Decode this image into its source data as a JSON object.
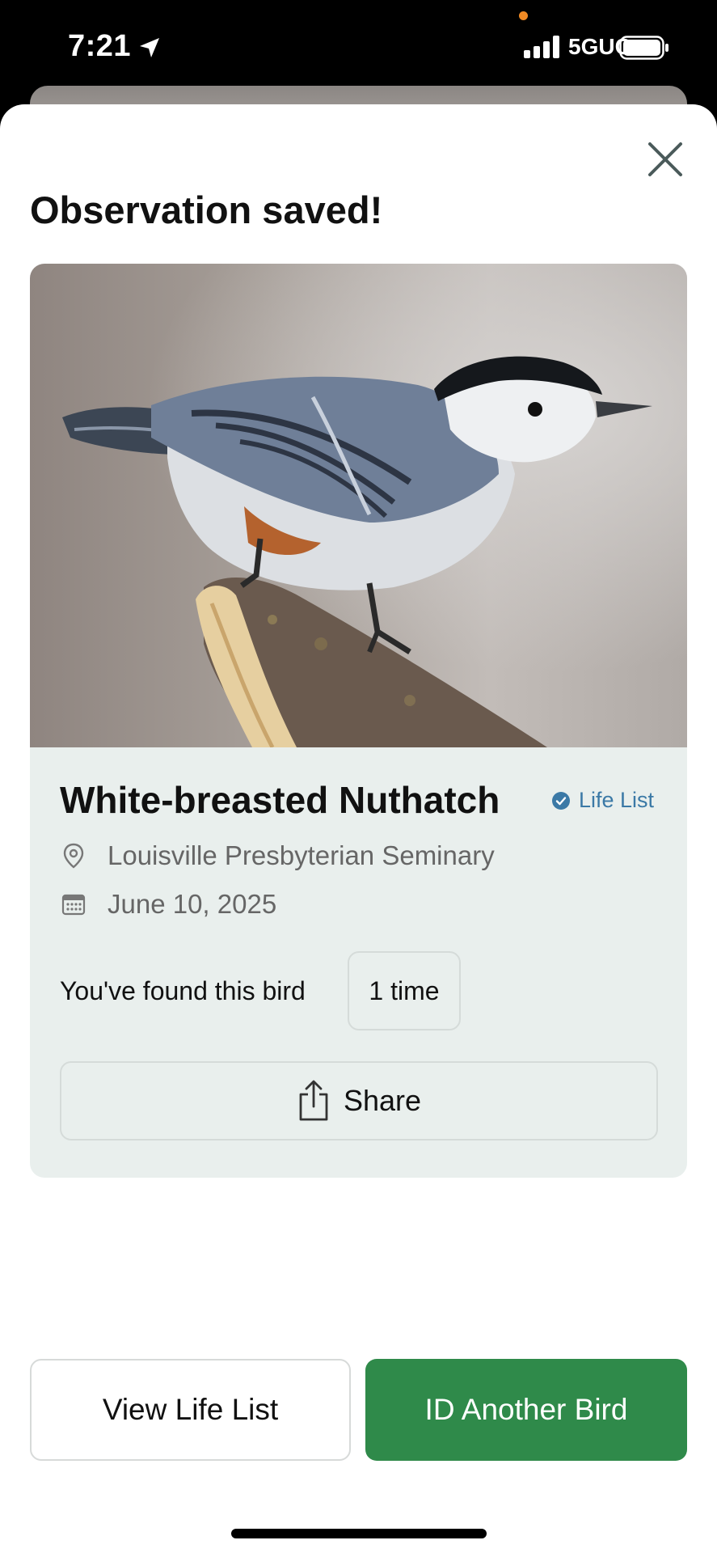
{
  "status_bar": {
    "time": "7:21",
    "network": "5GUC"
  },
  "modal": {
    "title": "Observation saved!"
  },
  "observation": {
    "species": "White-breasted Nuthatch",
    "badge_label": "Life List",
    "location": "Louisville Presbyterian Seminary",
    "date": "June 10, 2025",
    "found_text": "You've found this bird",
    "found_count": "1 time",
    "share_label": "Share"
  },
  "actions": {
    "view_life_list": "View Life List",
    "id_another_bird": "ID Another Bird"
  },
  "colors": {
    "accent_green": "#2f8a4a",
    "badge_blue": "#3b79a6",
    "card_bg": "#e9efed"
  },
  "icons": [
    "location-arrow-icon",
    "signal-icon",
    "battery-icon",
    "close-icon",
    "verified-check-icon",
    "location-pin-icon",
    "calendar-icon",
    "share-icon"
  ]
}
